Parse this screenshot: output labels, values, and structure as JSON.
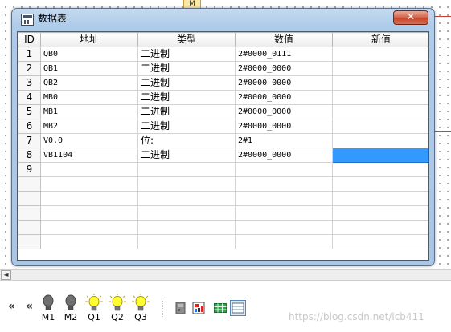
{
  "background": {
    "block_label": "M"
  },
  "dialog": {
    "title": "数据表",
    "close_icon": "close-icon"
  },
  "table": {
    "columns": [
      "ID",
      "地址",
      "类型",
      "数值",
      "新值"
    ],
    "rows": [
      {
        "id": "1",
        "address": "QB0",
        "type": "二进制",
        "value": "2#0000_0111",
        "new_value": ""
      },
      {
        "id": "2",
        "address": "QB1",
        "type": "二进制",
        "value": "2#0000_0000",
        "new_value": ""
      },
      {
        "id": "3",
        "address": "QB2",
        "type": "二进制",
        "value": "2#0000_0000",
        "new_value": ""
      },
      {
        "id": "4",
        "address": "MB0",
        "type": "二进制",
        "value": "2#0000_0000",
        "new_value": ""
      },
      {
        "id": "5",
        "address": "MB1",
        "type": "二进制",
        "value": "2#0000_0000",
        "new_value": ""
      },
      {
        "id": "6",
        "address": "MB2",
        "type": "二进制",
        "value": "2#0000_0000",
        "new_value": ""
      },
      {
        "id": "7",
        "address": "V0.0",
        "type": "位:",
        "value": "2#1",
        "new_value": ""
      },
      {
        "id": "8",
        "address": "VB1104",
        "type": "二进制",
        "value": "2#0000_0000",
        "new_value": ""
      },
      {
        "id": "9",
        "address": "",
        "type": "",
        "value": "",
        "new_value": ""
      }
    ],
    "selected_cell": {
      "row": 8,
      "column": "新值"
    }
  },
  "toolbar": {
    "nav_left_1": "«",
    "nav_left_2": "«",
    "lamps": [
      {
        "label": "M1",
        "state": "off"
      },
      {
        "label": "M2",
        "state": "off"
      },
      {
        "label": "Q1",
        "state": "on"
      },
      {
        "label": "Q2",
        "state": "on"
      },
      {
        "label": "Q3",
        "state": "on"
      }
    ],
    "icons": [
      "device-icon",
      "chart-icon",
      "table-green-icon",
      "table-view-icon"
    ]
  },
  "scrollbar": {
    "left_arrow": "◄"
  },
  "watermark": "https://blog.csdn.net/lcb411",
  "colors": {
    "selection": "#3399ff",
    "lamp_on": "#ffff33",
    "lamp_off": "#777777",
    "close_button": "#c9482e"
  }
}
